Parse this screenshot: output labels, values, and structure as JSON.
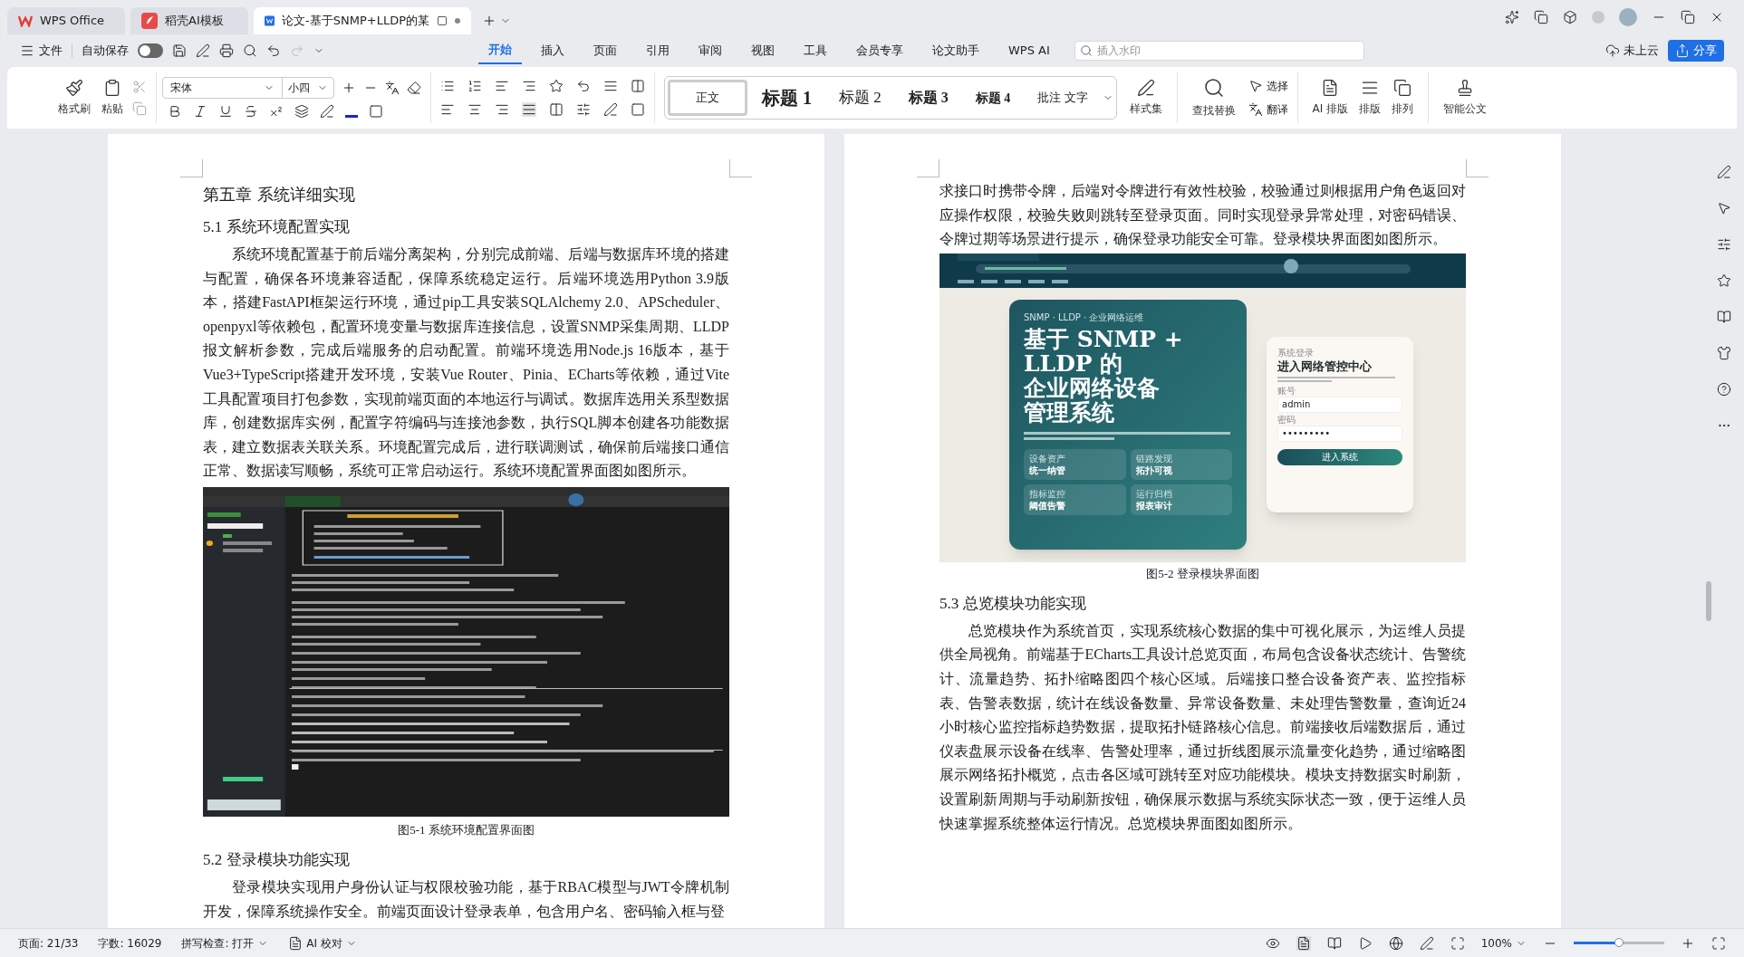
{
  "tabs": [
    {
      "kind": "wps",
      "label": "WPS Office",
      "selected": false
    },
    {
      "kind": "docer",
      "label": "稻壳AI模板",
      "selected": false
    },
    {
      "kind": "doc",
      "label": "论文-基于SNMP+LLDP的某",
      "selected": true
    }
  ],
  "quick_bar": {
    "file_menu": "文件",
    "autosave": {
      "label": "自动保存",
      "on": false
    }
  },
  "menu_tabs": [
    {
      "label": "开始",
      "selected": true
    },
    {
      "label": "插入",
      "selected": false
    },
    {
      "label": "页面",
      "selected": false
    },
    {
      "label": "引用",
      "selected": false
    },
    {
      "label": "审阅",
      "selected": false
    },
    {
      "label": "视图",
      "selected": false
    },
    {
      "label": "工具",
      "selected": false
    },
    {
      "label": "会员专享",
      "selected": false
    },
    {
      "label": "论文助手",
      "selected": false
    },
    {
      "label": "WPS AI",
      "selected": false
    }
  ],
  "search": {
    "placeholder": "插入水印"
  },
  "cloud": "未上云",
  "share": "分享",
  "ribbon": {
    "format_painter": "格式刷",
    "paste": "粘贴",
    "font": "宋体",
    "size": "小四",
    "styles": [
      {
        "label": "正文",
        "selected": true,
        "kind": "body"
      },
      {
        "label": "标题 1",
        "selected": false,
        "kind": "h1"
      },
      {
        "label": "标题 2",
        "selected": false,
        "kind": "h2"
      },
      {
        "label": "标题 3",
        "selected": false,
        "kind": "h3"
      },
      {
        "label": "标题 4",
        "selected": false,
        "kind": "h4"
      },
      {
        "label": "批注 文字",
        "selected": false,
        "kind": "note"
      }
    ],
    "style_set": "样式集",
    "find_replace": "查找替换",
    "select": "选择",
    "translate": "翻译",
    "ai_layout": "AI 排版",
    "layout": "排版",
    "arrange": "排列",
    "smart_doc": "智能公文"
  },
  "pages": [
    {
      "blocks": [
        {
          "kind": "h1",
          "text": "第五章 系统详细实现"
        },
        {
          "kind": "h2",
          "text": "5.1 系统环境配置实现"
        },
        {
          "kind": "para",
          "text": "系统环境配置基于前后端分离架构，分别完成前端、后端与数据库环境的搭建与配置，确保各环境兼容适配，保障系统稳定运行。后端环境选用Python 3.9版本，搭建FastAPI框架运行环境，通过pip工具安装SQLAlchemy 2.0、APScheduler、openpyxl等依赖包，配置环境变量与数据库连接信息，设置SNMP采集周期、LLDP报文解析参数，完成后端服务的启动配置。前端环境选用Node.js 16版本，基于Vue3+TypeScript搭建开发环境，安装Vue Router、Pinia、ECharts等依赖，通过Vite工具配置项目打包参数，实现前端页面的本地运行与调试。数据库选用关系型数据库，创建数据库实例，配置字符编码与连接池参数，执行SQL脚本创建各功能数据表，建立数据表关联关系。环境配置完成后，进行联调测试，确保前后端接口通信正常、数据读写顺畅，系统可正常启动运行。系统环境配置界面图如图所示。"
        },
        {
          "kind": "figure",
          "figure": {
            "kind": "terminal"
          }
        },
        {
          "kind": "caption",
          "text": "图5-1 系统环境配置界面图"
        },
        {
          "kind": "h2",
          "text": "5.2 登录模块功能实现"
        },
        {
          "kind": "para",
          "text": "登录模块实现用户身份认证与权限校验功能，基于RBAC模型与JWT令牌机制开发，保障系统操作安全。前端页面设计登录表单，包含用户名、密码输入框与登"
        }
      ]
    },
    {
      "blocks": [
        {
          "kind": "para_continued",
          "text": "求接口时携带令牌，后端对令牌进行有效性校验，校验通过则根据用户角色返回对应操作权限，校验失败则跳转至登录页面。同时实现登录异常处理，对密码错误、令牌过期等场景进行提示，确保登录功能安全可靠。登录模块界面图如图所示。"
        },
        {
          "kind": "figure",
          "figure": {
            "kind": "login",
            "eyebrow": "SNMP · LLDP · 企业网络运维",
            "title_lines": [
              "基于 SNMP +",
              "LLDP 的",
              "企业网络设备",
              "管理系统"
            ],
            "tiles": [
              {
                "label": "设备资产",
                "value": "统一纳管"
              },
              {
                "label": "链路发现",
                "value": "拓扑可视"
              },
              {
                "label": "指标监控",
                "value": "阈值告警"
              },
              {
                "label": "运行归档",
                "value": "报表审计"
              }
            ],
            "form_eyebrow": "系统登录",
            "form_title": "进入网络管控中心",
            "account_label": "账号",
            "account": "admin",
            "password_label": "密码",
            "password": "•••••••••",
            "submit": "进入系统"
          }
        },
        {
          "kind": "caption",
          "text": "图5-2 登录模块界面图"
        },
        {
          "kind": "h2",
          "text": "5.3 总览模块功能实现"
        },
        {
          "kind": "para",
          "text": "总览模块作为系统首页，实现系统核心数据的集中可视化展示，为运维人员提供全局视角。前端基于ECharts工具设计总览页面，布局包含设备状态统计、告警统计、流量趋势、拓扑缩略图四个核心区域。后端接口整合设备资产表、监控指标表、告警表数据，统计在线设备数量、异常设备数量、未处理告警数量，查询近24小时核心监控指标趋势数据，提取拓扑链路核心信息。前端接收后端数据后，通过仪表盘展示设备在线率、告警处理率，通过折线图展示流量变化趋势，通过缩略图展示网络拓扑概览，点击各区域可跳转至对应功能模块。模块支持数据实时刷新，设置刷新周期与手动刷新按钮，确保展示数据与系统实际状态一致，便于运维人员快速掌握系统整体运行情况。总览模块界面图如图所示。"
        }
      ]
    }
  ],
  "status_bar": {
    "page": "页面: 21/33",
    "words": "字数: 16029",
    "spell": "拼写检查: 打开",
    "ai_check": "AI 校对",
    "zoom": "100%",
    "zoom_slider": {
      "level": 0.5
    }
  }
}
